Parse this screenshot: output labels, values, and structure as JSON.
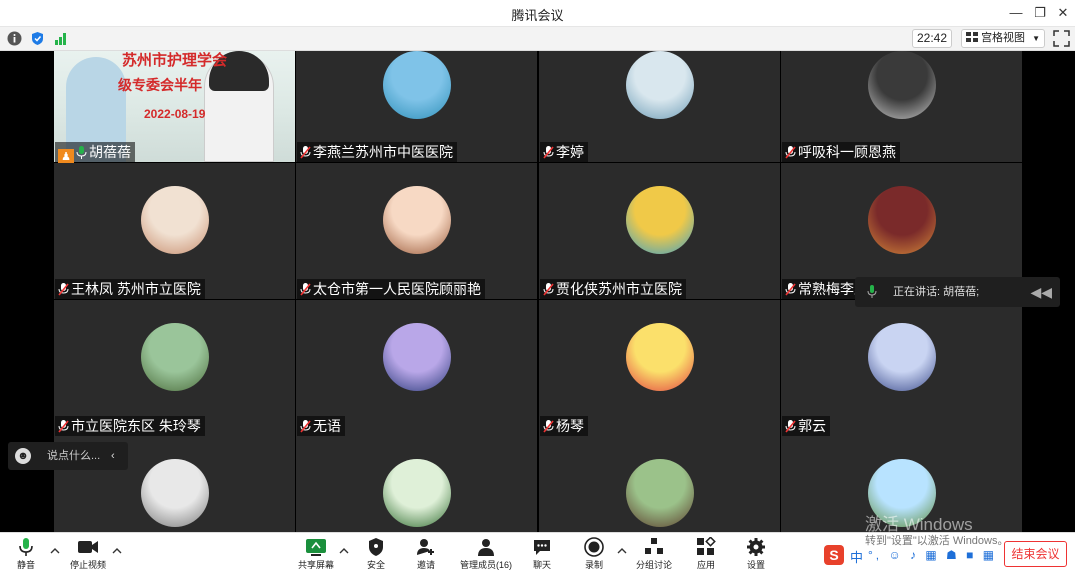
{
  "window": {
    "title": "腾讯会议"
  },
  "infobar": {
    "clock": "22:42",
    "view_label": "宫格视图"
  },
  "participants": [
    {
      "name": "胡蓓蓓",
      "video": true,
      "banner": "苏州市护理学会",
      "banner2": "级专委会半年",
      "date": "2022-08-19"
    },
    {
      "name": "李燕兰苏州市中医医院"
    },
    {
      "name": "李婷"
    },
    {
      "name": "呼吸科一顾恩燕"
    },
    {
      "name": "王林凤 苏州市立医院"
    },
    {
      "name": "太仓市第一人民医院顾丽艳"
    },
    {
      "name": "贾化侠苏州市立医院"
    },
    {
      "name": "常熟梅李卫"
    },
    {
      "name": "市立医院东区 朱玲琴"
    },
    {
      "name": "无语"
    },
    {
      "name": "杨琴"
    },
    {
      "name": "郭云"
    },
    {
      "name": ""
    },
    {
      "name": ""
    },
    {
      "name": ""
    },
    {
      "name": ""
    }
  ],
  "speaking": {
    "label": "正在讲话: 胡蓓蓓;"
  },
  "chat": {
    "placeholder": "说点什么..."
  },
  "toolbar": {
    "mute": "静音",
    "stop_video": "停止视频",
    "share": "共享屏幕",
    "security": "安全",
    "invite": "邀请",
    "members": "管理成员(16)",
    "chat": "聊天",
    "record": "录制",
    "breakout": "分组讨论",
    "apps": "应用",
    "settings": "设置",
    "end": "结束会议"
  },
  "watermark": {
    "line1": "激活 Windows",
    "line2": "转到\"设置\"以激活 Windows。"
  },
  "ime": {
    "label": "中"
  },
  "colors": {
    "accent": "#1e7be6",
    "end": "#e33333",
    "green": "#25b34a",
    "tile": "#2b2b2b"
  }
}
